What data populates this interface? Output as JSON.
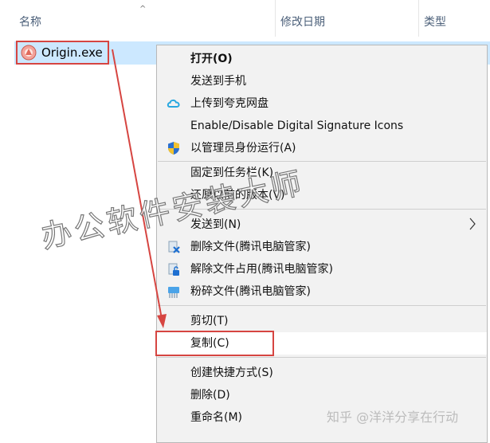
{
  "header": {
    "columns": [
      {
        "label": "名称"
      },
      {
        "label": "修改日期"
      },
      {
        "label": "类型"
      }
    ]
  },
  "file": {
    "name": "Origin.exe",
    "icon": "origin-app-icon"
  },
  "menu": {
    "items": [
      {
        "label": "打开(O)",
        "bold": true
      },
      {
        "label": "发送到手机"
      },
      {
        "label": "上传到夸克网盘",
        "icon": "quark-cloud-icon"
      },
      {
        "label": "Enable/Disable Digital Signature Icons"
      },
      {
        "label": "以管理员身份运行(A)",
        "icon": "uac-shield-icon"
      },
      {
        "label": "固定到任务栏(K)"
      },
      {
        "label": "还原以前的版本(V)"
      },
      {
        "label": "发送到(N)",
        "submenu": true
      },
      {
        "label": "删除文件(腾讯电脑管家)",
        "icon": "tencent-delete-icon"
      },
      {
        "label": "解除文件占用(腾讯电脑管家)",
        "icon": "tencent-unlock-icon"
      },
      {
        "label": "粉碎文件(腾讯电脑管家)",
        "icon": "tencent-shred-icon"
      },
      {
        "label": "剪切(T)"
      },
      {
        "label": "复制(C)"
      },
      {
        "label": "创建快捷方式(S)"
      },
      {
        "label": "删除(D)"
      },
      {
        "label": "重命名(M)"
      }
    ]
  },
  "watermark": {
    "diagonal": "办公软件安装大师",
    "bottom": "知乎 @洋洋分享在行动"
  },
  "colors": {
    "highlight_red": "#d64541",
    "selection_blue": "#cce8ff",
    "menu_bg": "#f2f2f2"
  }
}
